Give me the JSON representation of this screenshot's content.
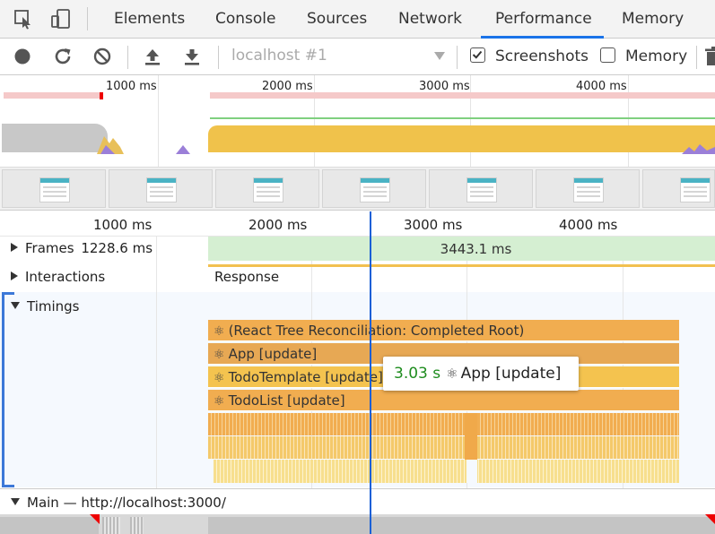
{
  "tabbar": {
    "tabs": [
      {
        "label": "Elements"
      },
      {
        "label": "Console"
      },
      {
        "label": "Sources"
      },
      {
        "label": "Network"
      },
      {
        "label": "Performance",
        "active": true
      },
      {
        "label": "Memory"
      }
    ]
  },
  "toolbar": {
    "profile_select": "localhost #1",
    "screenshots_label": "Screenshots",
    "screenshots_checked": true,
    "memory_label": "Memory",
    "memory_checked": false
  },
  "overview": {
    "ticks": [
      "1000 ms",
      "2000 ms",
      "3000 ms",
      "4000 ms"
    ]
  },
  "ruler": {
    "ticks": [
      "1000 ms",
      "2000 ms",
      "3000 ms",
      "4000 ms"
    ]
  },
  "tracks": {
    "frames": {
      "label": "Frames",
      "value": "1228.6 ms",
      "bar_value": "3443.1 ms"
    },
    "interactions": {
      "label": "Interactions",
      "value": "Response"
    },
    "timings": {
      "label": "Timings"
    },
    "main": {
      "label": "Main — http://localhost:3000/"
    }
  },
  "timings_entries": [
    {
      "label": "(React Tree Reconciliation: Completed Root)",
      "color": "#f1ad50"
    },
    {
      "label": "App [update]",
      "color": "#e7a854"
    },
    {
      "label": "TodoTemplate [update]",
      "color": "#f4c34f"
    },
    {
      "label": "TodoList [update]",
      "color": "#f1ad50"
    }
  ],
  "tooltip": {
    "time": "3.03 s",
    "label": "App [update]"
  },
  "colors": {
    "accent": "#1a73e8",
    "timeline_cursor": "#1a5fd6",
    "tooltip_time": "#1e8c1e"
  }
}
